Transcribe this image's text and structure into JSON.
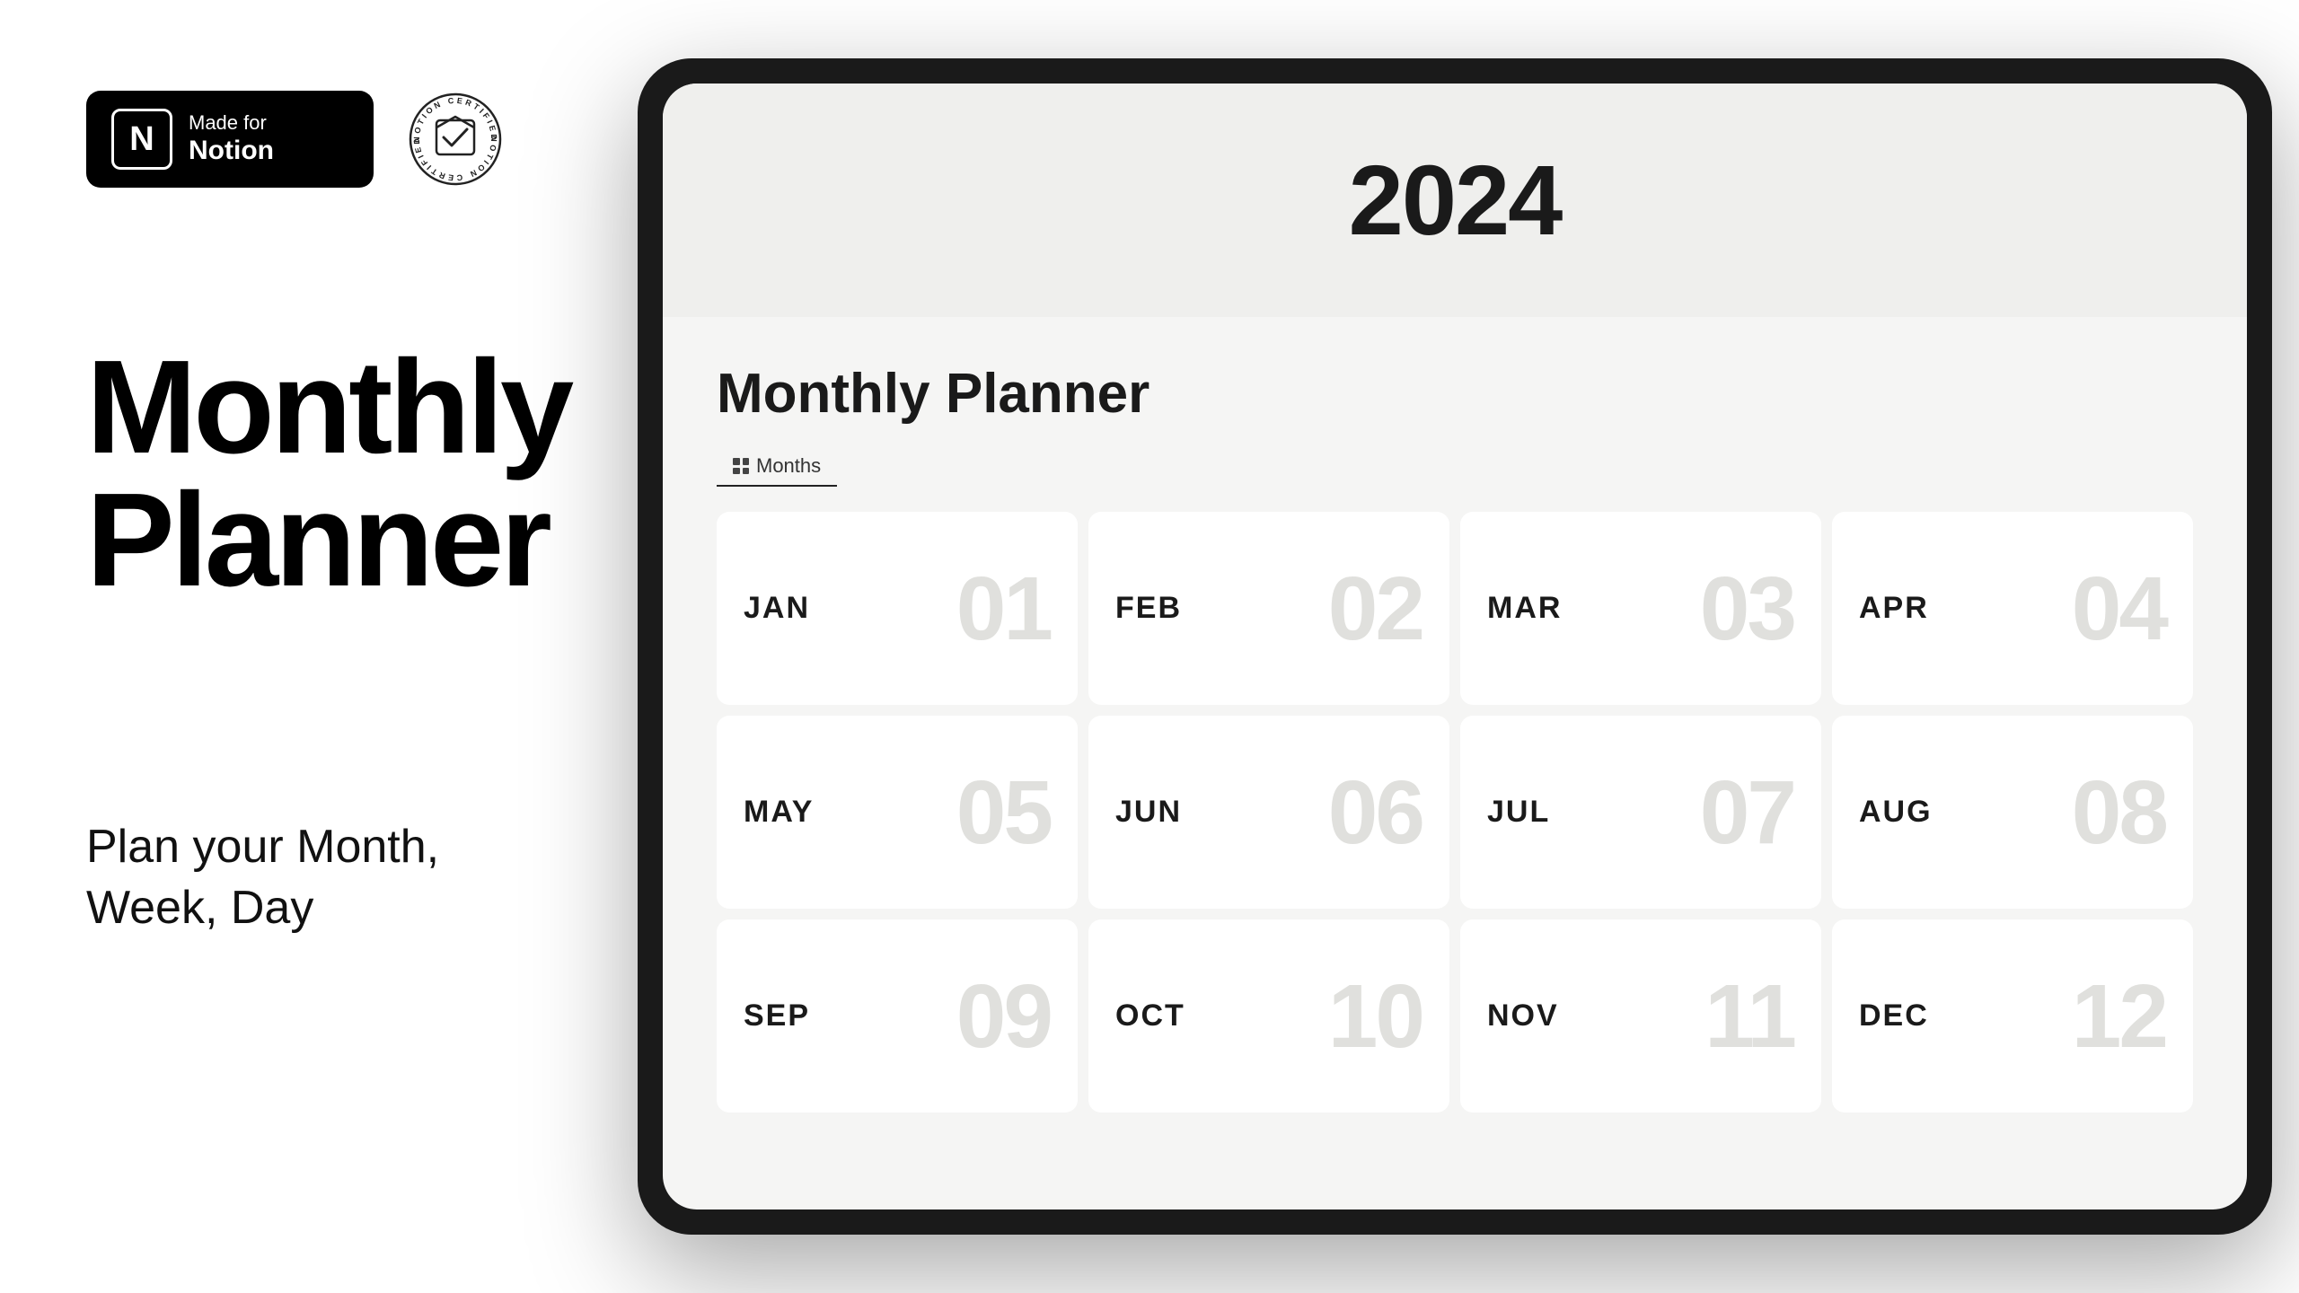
{
  "left": {
    "made_for_notion_line1": "Made for",
    "made_for_notion_line2": "Notion",
    "notion_icon_letter": "N",
    "certified_text": "NOTION CERTIFIED",
    "main_title_line1": "Monthly",
    "main_title_line2": "Planner",
    "subtitle": "Plan your Month,\nWeek, Day"
  },
  "tablet": {
    "year": "2024",
    "planner_title": "Monthly Planner",
    "tab_label": "Months",
    "months": [
      {
        "name": "JAN",
        "num": "01"
      },
      {
        "name": "FEB",
        "num": "02"
      },
      {
        "name": "MAR",
        "num": "03"
      },
      {
        "name": "APR",
        "num": "04"
      },
      {
        "name": "MAY",
        "num": "05"
      },
      {
        "name": "JUN",
        "num": "06"
      },
      {
        "name": "JUL",
        "num": "07"
      },
      {
        "name": "AUG",
        "num": "08"
      },
      {
        "name": "SEP",
        "num": "09"
      },
      {
        "name": "OCT",
        "num": "10"
      },
      {
        "name": "NOV",
        "num": "11"
      },
      {
        "name": "DEC",
        "num": "12"
      }
    ]
  }
}
